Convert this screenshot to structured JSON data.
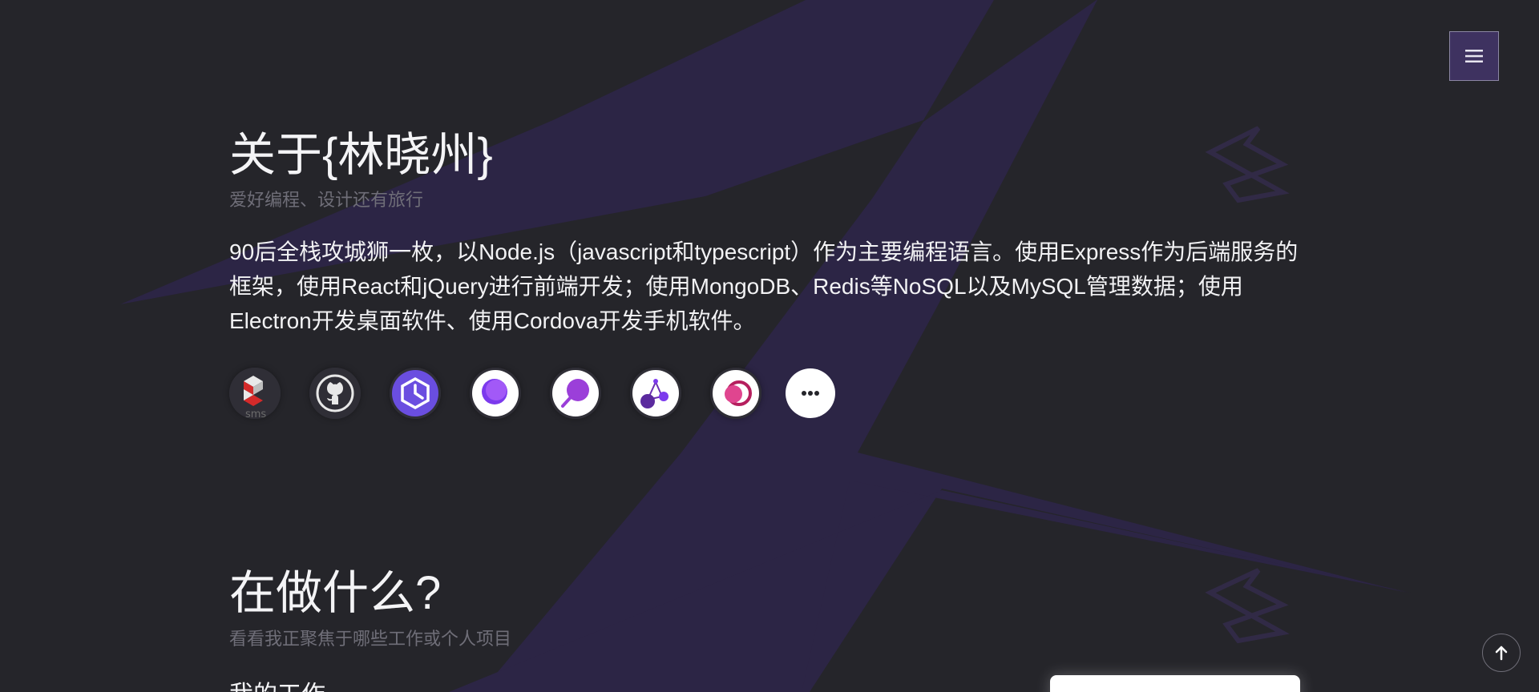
{
  "about": {
    "title": "关于{林晓州}",
    "subtitle": "爱好编程、设计还有旅行",
    "description": "90后全栈攻城狮一枚，以Node.js（javascript和typescript）作为主要编程语言。使用Express作为后端服务的框架，使用React和jQuery进行前端开发；使用MongoDB、Redis等NoSQL以及MySQL管理数据；使用Electron开发桌面软件、使用Cordova开发手机软件。",
    "tech_icons": [
      {
        "name": "sms-logo-icon"
      },
      {
        "name": "github-icon"
      },
      {
        "name": "clock-badge-icon"
      },
      {
        "name": "moon-circle-icon"
      },
      {
        "name": "lollipop-icon"
      },
      {
        "name": "molecule-icon"
      },
      {
        "name": "rings-icon"
      }
    ],
    "sms_text": "sms"
  },
  "doing": {
    "title": "在做什么?",
    "subtitle": "看看我正聚焦于哪些工作或个人项目",
    "work_heading": "我的工作"
  },
  "nav": {
    "menu_icon": "hamburger-icon",
    "scroll_top_icon": "arrow-up-icon"
  },
  "colors": {
    "background": "#25252a",
    "accent_purple": "#3e3260",
    "shape_purple": "#2f2647",
    "subtitle_gray": "#6f6e78"
  }
}
